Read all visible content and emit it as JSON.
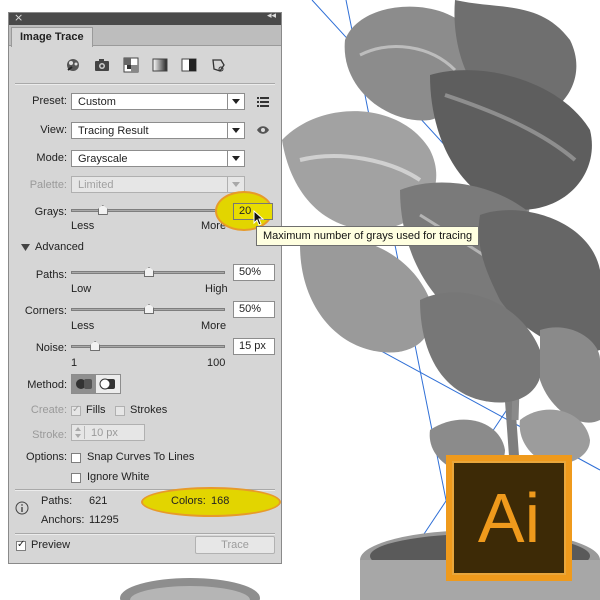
{
  "panel": {
    "tab_title": "Image Trace",
    "close_glyph": "×",
    "collapse_glyph": "◂◂",
    "preset": {
      "label": "Preset:",
      "value": "Custom"
    },
    "view": {
      "label": "View:",
      "value": "Tracing Result"
    },
    "mode": {
      "label": "Mode:",
      "value": "Grayscale"
    },
    "palette": {
      "label": "Palette:",
      "value": "Limited"
    },
    "grays": {
      "label": "Grays:",
      "value": "20",
      "min_label": "Less",
      "max_label": "More",
      "level": 0.2
    },
    "advanced_label": "Advanced",
    "paths": {
      "label": "Paths:",
      "value": "50%",
      "min_label": "Low",
      "max_label": "High",
      "level": 0.5
    },
    "corners": {
      "label": "Corners:",
      "value": "50%",
      "min_label": "Less",
      "max_label": "More",
      "level": 0.5
    },
    "noise": {
      "label": "Noise:",
      "value": "15 px",
      "min_label": "1",
      "max_label": "100",
      "level": 0.15
    },
    "method": {
      "label": "Method:"
    },
    "create": {
      "label": "Create:",
      "fills": "Fills",
      "strokes": "Strokes",
      "fills_checked": true,
      "strokes_checked": false
    },
    "stroke": {
      "label": "Stroke:",
      "value": "10 px"
    },
    "options": {
      "label": "Options:",
      "snap": "Snap Curves To Lines",
      "ignore": "Ignore White"
    },
    "stats": {
      "paths_label": "Paths:",
      "paths_value": "621",
      "anchors_label": "Anchors:",
      "anchors_value": "11295",
      "colors_label": "Colors:",
      "colors_value": "168"
    },
    "preview": {
      "label": "Preview",
      "checked": true
    },
    "trace_button": "Trace"
  },
  "tooltip": {
    "text": "Maximum number of grays used for tracing"
  },
  "logo": {
    "text": "Ai",
    "color": "#ef9a1c",
    "background": "#3d2a06"
  },
  "icons": [
    "auto-color-icon",
    "high-color-icon",
    "low-color-icon",
    "grayscale-icon",
    "black-white-icon",
    "outline-icon",
    "menu-icon",
    "eye-icon",
    "info-icon"
  ],
  "colors": {
    "panel": "#d6d6d6",
    "highlight": "#e2d500",
    "highlight_border": "#e79a2a",
    "guide": "#2f6fd6"
  }
}
